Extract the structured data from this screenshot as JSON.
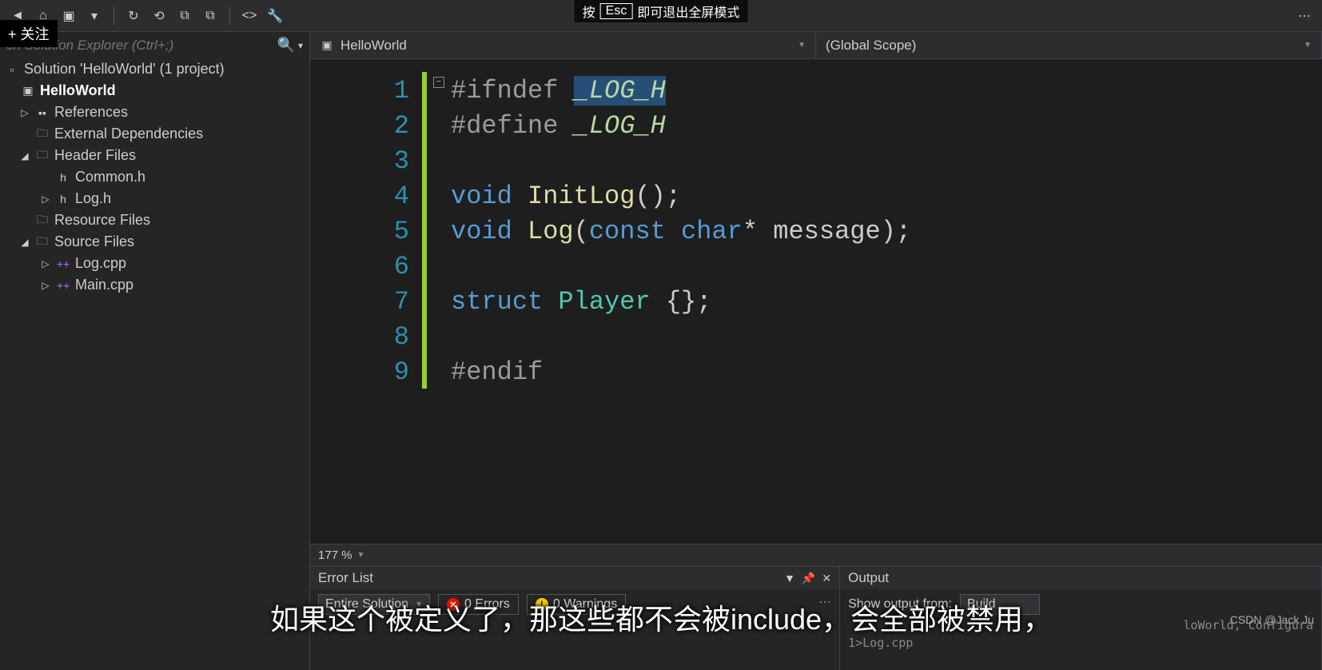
{
  "overlay": {
    "pre": "按",
    "key": "Esc",
    "post": "即可退出全屏模式"
  },
  "follow": "+ 关注",
  "toolbar": {
    "icons": [
      "back-icon",
      "home-icon",
      "new-item-icon",
      "dropdown-icon",
      "history-icon",
      "refresh-icon",
      "copy-icon",
      "paste-icon",
      "code-icon",
      "wrench-icon"
    ]
  },
  "search": {
    "placeholder": "ch Solution Explorer (Ctrl+;)"
  },
  "tree": {
    "solution": "Solution 'HelloWorld' (1 project)",
    "project": "HelloWorld",
    "nodes": [
      {
        "label": "References",
        "exp": "▷",
        "icon": "references-icon"
      },
      {
        "label": "External Dependencies",
        "exp": "",
        "icon": "folder-icon"
      },
      {
        "label": "Header Files",
        "exp": "◢",
        "icon": "folder-icon",
        "children": [
          {
            "label": "Common.h",
            "exp": "",
            "icon": "h-file-icon"
          },
          {
            "label": "Log.h",
            "exp": "▷",
            "icon": "h-file-icon"
          }
        ]
      },
      {
        "label": "Resource Files",
        "exp": "",
        "icon": "folder-icon"
      },
      {
        "label": "Source Files",
        "exp": "◢",
        "icon": "folder-icon",
        "children": [
          {
            "label": "Log.cpp",
            "exp": "▷",
            "icon": "cpp-file-icon"
          },
          {
            "label": "Main.cpp",
            "exp": "▷",
            "icon": "cpp-file-icon"
          }
        ]
      }
    ]
  },
  "nav": {
    "left": "HelloWorld",
    "right": "(Global Scope)"
  },
  "code": {
    "lines": [
      1,
      2,
      3,
      4,
      5,
      6,
      7,
      8,
      9
    ],
    "src": {
      "l1a": "#ifndef",
      "l1b": "_LOG_H",
      "l2a": "#define",
      "l2b": "_LOG_H",
      "void": "void",
      "init": "InitLog",
      "paren_semi": "();",
      "log": "Log",
      "logargs": "(",
      "const": "const",
      "char": "char",
      "star_msg": "* message);",
      "struct": "struct",
      "player": "Player",
      "braces": " {};",
      "endif": "#endif"
    }
  },
  "zoom": "177 %",
  "errorlist": {
    "title": "Error List",
    "scope": "Entire Solution",
    "errors": "0 Errors",
    "warnings": "0 Warnings"
  },
  "output": {
    "title": "Output",
    "show_from": "Show output from:",
    "source": "Build",
    "line1": "loWorld, Configura",
    "line2": "1>Log.cpp"
  },
  "caption": "如果这个被定义了，那这些都不会被include，会全部被禁用，",
  "watermark": "CSDN @Jack Ju"
}
